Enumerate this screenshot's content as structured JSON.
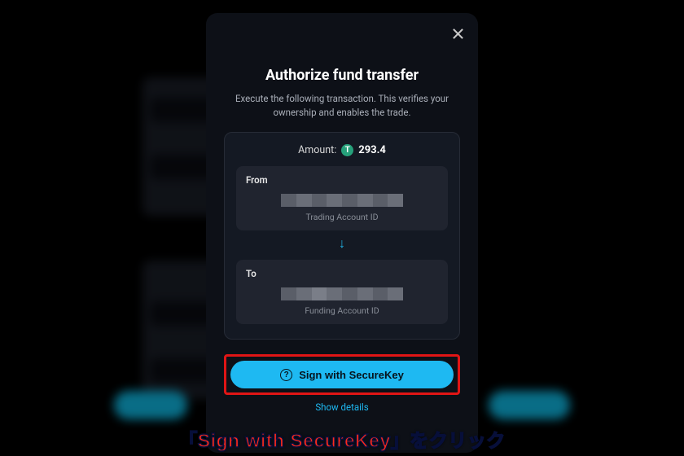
{
  "modal": {
    "title": "Authorize fund transfer",
    "subtitle": "Execute the following transaction. This verifies your ownership and enables the trade.",
    "amount_label": "Amount:",
    "amount_value": "293.4",
    "token_symbol": "T",
    "from": {
      "label": "From",
      "sub": "Trading Account ID"
    },
    "to": {
      "label": "To",
      "sub": "Funding Account ID"
    },
    "sign_button": "Sign with SecureKey",
    "show_details": "Show details"
  },
  "annotation": {
    "caption": "「Sign with SecureKey」をクリック"
  },
  "colors": {
    "accent": "#1eb9f2",
    "highlight_box": "#e01515",
    "token_green": "#26a17b"
  }
}
